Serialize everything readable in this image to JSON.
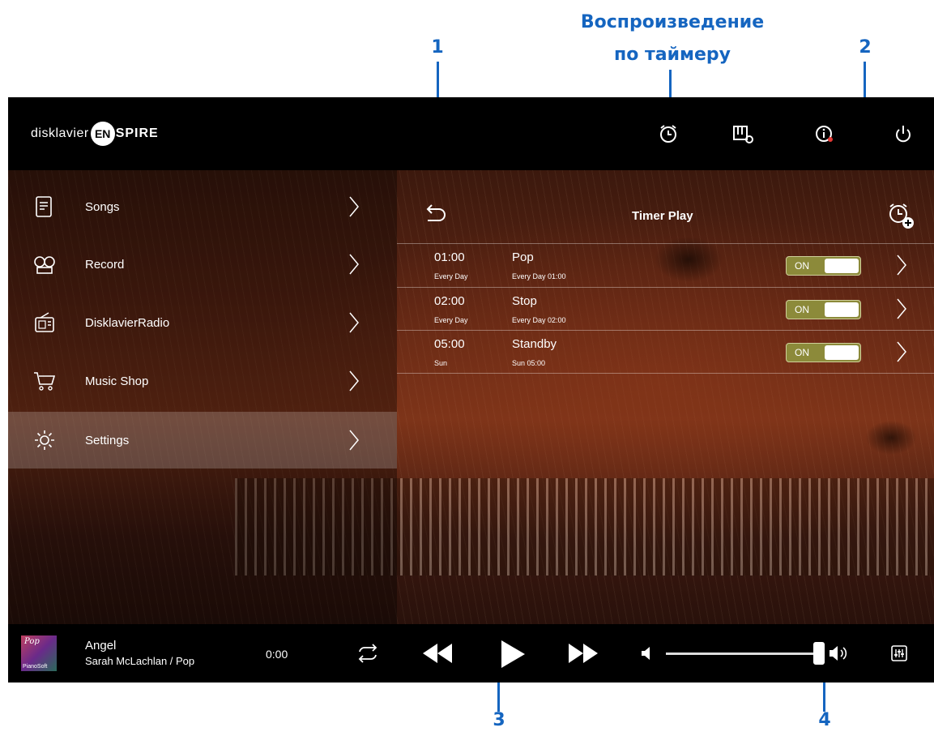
{
  "annotations": {
    "timer_label_line1": "Воспроизведение",
    "timer_label_line2": "по таймеру",
    "num1": "1",
    "num2": "2",
    "num3": "3",
    "num4": "4"
  },
  "header": {
    "logo_prefix": "disklavier",
    "logo_en": "EN",
    "logo_suffix": "SPIRE",
    "icons": [
      "alarm-clock-icon",
      "piano-settings-icon",
      "info-icon",
      "power-icon"
    ]
  },
  "sidebar": {
    "items": [
      {
        "label": "Songs",
        "icon": "songs-icon"
      },
      {
        "label": "Record",
        "icon": "record-icon"
      },
      {
        "label": "DisklavierRadio",
        "icon": "radio-icon"
      },
      {
        "label": "Music Shop",
        "icon": "cart-icon"
      },
      {
        "label": "Settings",
        "icon": "gear-icon",
        "active": true
      }
    ]
  },
  "panel": {
    "title": "Timer Play",
    "timers": [
      {
        "time": "01:00",
        "repeat": "Every Day",
        "name": "Pop",
        "detail": "Every Day 01:00",
        "toggle": "ON"
      },
      {
        "time": "02:00",
        "repeat": "Every Day",
        "name": "Stop",
        "detail": "Every Day 02:00",
        "toggle": "ON"
      },
      {
        "time": "05:00",
        "repeat": "Sun",
        "name": "Standby",
        "detail": "Sun 05:00",
        "toggle": "ON"
      }
    ]
  },
  "player": {
    "album_genre": "Pop",
    "album_brand": "PianoSoft",
    "title": "Angel",
    "artist": "Sarah McLachlan / Pop",
    "time": "0:00",
    "volume": 0.97
  },
  "colors": {
    "annotation": "#1565c0",
    "toggle_on": "#8c8a3a"
  }
}
